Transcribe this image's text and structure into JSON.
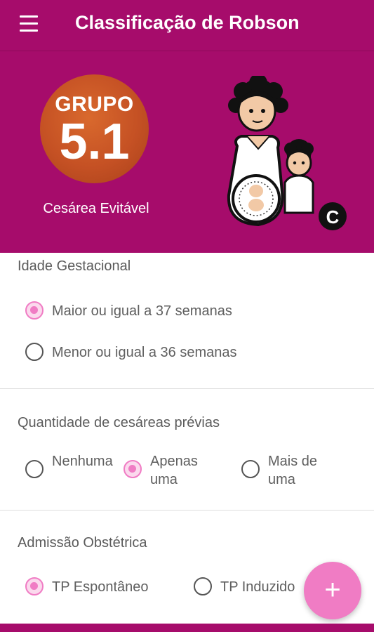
{
  "appbar": {
    "title": "Classificação de Robson",
    "menu_icon": "hamburger-menu-icon"
  },
  "hero": {
    "badge_label": "GRUPO",
    "badge_number": "5.1",
    "subtitle": "Cesárea Evitável",
    "illustration_letter": "C",
    "colors": {
      "background": "#a60c6b",
      "badge": "#c55124"
    }
  },
  "sections": {
    "gestational_age": {
      "title": "Idade Gestacional",
      "options": [
        {
          "label": "Maior ou igual a 37 semanas",
          "checked": true
        },
        {
          "label": "Menor ou igual a 36 semanas",
          "checked": false
        }
      ]
    },
    "previous_cesareans": {
      "title": "Quantidade de cesáreas prévias",
      "options": [
        {
          "label": "Nenhuma",
          "checked": false
        },
        {
          "label": "Apenas uma",
          "checked": true
        },
        {
          "label": "Mais de uma",
          "checked": false
        }
      ]
    },
    "obstetric_admission": {
      "title": "Admissão Obstétrica",
      "options": [
        {
          "label": "TP Espontâneo",
          "checked": true
        },
        {
          "label": "TP Induzido",
          "checked": false
        }
      ]
    }
  },
  "fab": {
    "label": "+",
    "icon": "plus-icon",
    "color": "#f07cc4"
  },
  "accent_color": "#f07cc4"
}
